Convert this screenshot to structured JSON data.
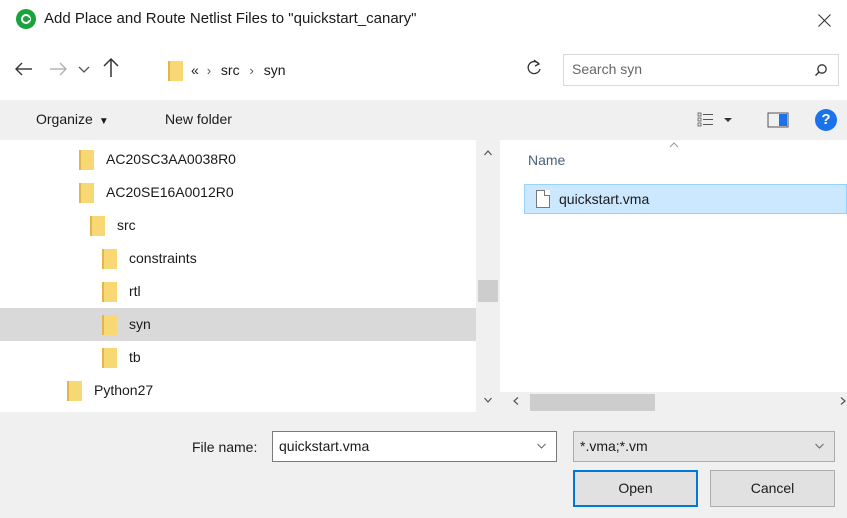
{
  "window": {
    "title": "Add Place and Route Netlist Files to \"quickstart_canary\"",
    "close_glyph": "✕"
  },
  "address": {
    "overflow": "«",
    "crumbs": [
      "src",
      "syn"
    ],
    "separator": "›"
  },
  "search": {
    "placeholder": "Search syn"
  },
  "toolbar": {
    "organize_label": "Organize",
    "new_folder_label": "New folder",
    "help_label": "?"
  },
  "tree": {
    "items": [
      {
        "label": "AC20SC3AA0038R0",
        "selected": false
      },
      {
        "label": "AC20SE16A0012R0",
        "selected": false
      },
      {
        "label": "src",
        "selected": false
      },
      {
        "label": "constraints",
        "selected": false
      },
      {
        "label": "rtl",
        "selected": false
      },
      {
        "label": "syn",
        "selected": true
      },
      {
        "label": "tb",
        "selected": false
      },
      {
        "label": "Python27",
        "selected": false
      }
    ]
  },
  "filelist": {
    "column_name": "Name",
    "files": [
      {
        "name": "quickstart.vma",
        "selected": true
      }
    ]
  },
  "bottom": {
    "file_name_label": "File name:",
    "file_name_value": "quickstart.vma",
    "file_type_value": "*.vma;*.vm",
    "open_label": "Open",
    "cancel_label": "Cancel"
  },
  "colors": {
    "accent": "#0078d7",
    "selection_bg": "#cce8ff",
    "folder": "#f8d775",
    "app_icon": "#1aa33c"
  }
}
